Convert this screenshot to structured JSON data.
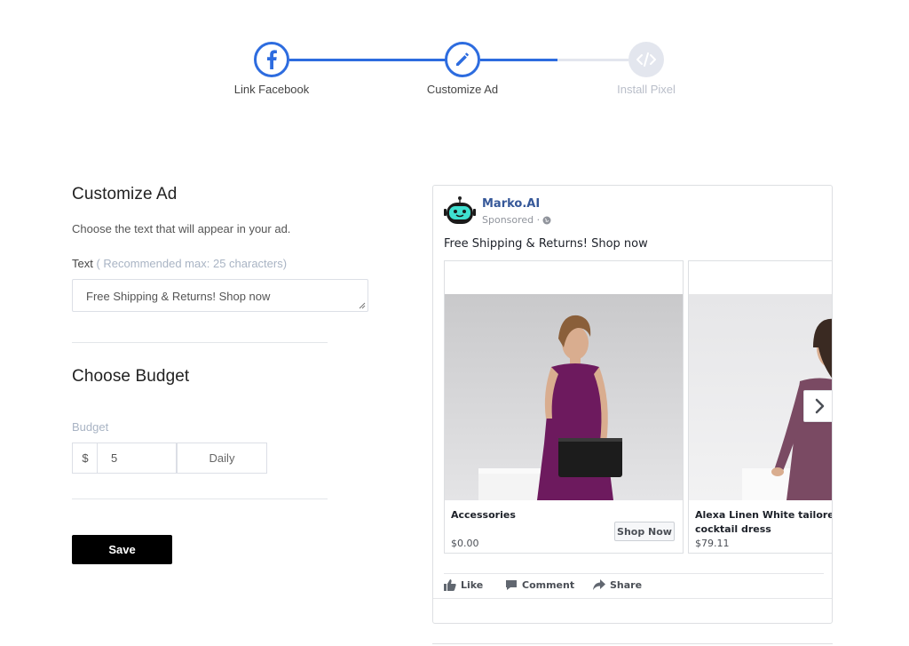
{
  "stepper": {
    "steps": [
      {
        "label": "Link Facebook",
        "icon": "facebook-icon",
        "state": "complete"
      },
      {
        "label": "Customize Ad",
        "icon": "pencil-icon",
        "state": "current"
      },
      {
        "label": "Install Pixel",
        "icon": "code-icon",
        "state": "upcoming"
      }
    ],
    "accent_color": "#2d6cdf",
    "inactive_color": "#e3e6ee"
  },
  "customize": {
    "title": "Customize Ad",
    "description": "Choose the text that will appear in your ad.",
    "text_label": "Text",
    "text_hint": "( Recommended max: 25 characters)",
    "text_value": "Free Shipping & Returns! Shop now"
  },
  "budget": {
    "title": "Choose Budget",
    "label": "Budget",
    "currency": "$",
    "amount": "5",
    "period": "Daily"
  },
  "actions": {
    "save_label": "Save"
  },
  "preview": {
    "page_name": "Marko.AI",
    "sponsored": "Sponsored ·",
    "ad_text": "Free Shipping & Returns! Shop now",
    "cards": [
      {
        "title": "Accessories",
        "price": "$0.00",
        "cta": "Shop Now"
      },
      {
        "title": "Alexa Linen White tailored cocktail dress",
        "price": "$79.11"
      }
    ],
    "reactions": {
      "like": "Like",
      "comment": "Comment",
      "share": "Share"
    },
    "link_color": "#365899"
  }
}
